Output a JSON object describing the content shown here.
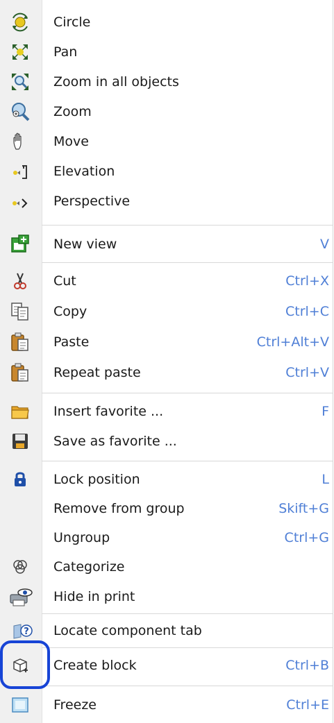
{
  "menu": {
    "items": [
      {
        "label": "Circle",
        "shortcut": "",
        "icon": "circle-rotate-icon"
      },
      {
        "label": "Pan",
        "shortcut": "",
        "icon": "pan-icon"
      },
      {
        "label": "Zoom in all objects",
        "shortcut": "",
        "icon": "zoom-all-icon"
      },
      {
        "label": "Zoom",
        "shortcut": "",
        "icon": "zoom-icon"
      },
      {
        "label": "Move",
        "shortcut": "",
        "icon": "hand-icon"
      },
      {
        "label": "Elevation",
        "shortcut": "",
        "icon": "elevation-icon"
      },
      {
        "label": "Perspective",
        "shortcut": "",
        "icon": "perspective-icon"
      },
      {
        "label": "New view",
        "shortcut": "V",
        "icon": "new-view-icon"
      },
      {
        "label": "Cut",
        "shortcut": "Ctrl+X",
        "icon": "scissors-icon"
      },
      {
        "label": "Copy",
        "shortcut": "Ctrl+C",
        "icon": "copy-icon"
      },
      {
        "label": "Paste",
        "shortcut": "Ctrl+Alt+V",
        "icon": "paste-icon"
      },
      {
        "label": "Repeat paste",
        "shortcut": "Ctrl+V",
        "icon": "repeat-paste-icon"
      },
      {
        "label": "Insert favorite ...",
        "shortcut": "F",
        "icon": "folder-icon"
      },
      {
        "label": "Save as favorite ...",
        "shortcut": "",
        "icon": "floppy-icon"
      },
      {
        "label": "Lock position",
        "shortcut": "L",
        "icon": "lock-icon"
      },
      {
        "label": "Remove from group",
        "shortcut": "Skift+G",
        "icon": ""
      },
      {
        "label": "Ungroup",
        "shortcut": "Ctrl+G",
        "icon": ""
      },
      {
        "label": "Categorize",
        "shortcut": "",
        "icon": "categorize-icon"
      },
      {
        "label": "Hide in print",
        "shortcut": "",
        "icon": "hide-print-icon"
      },
      {
        "label": "Locate component tab",
        "shortcut": "",
        "icon": "help-tab-icon"
      },
      {
        "label": "Create block",
        "shortcut": "Ctrl+B",
        "icon": "cube-add-icon"
      },
      {
        "label": "Freeze",
        "shortcut": "Ctrl+E",
        "icon": "freeze-icon"
      }
    ]
  },
  "colors": {
    "shortcut": "#4f7fd6",
    "highlight": "#1744d6"
  }
}
